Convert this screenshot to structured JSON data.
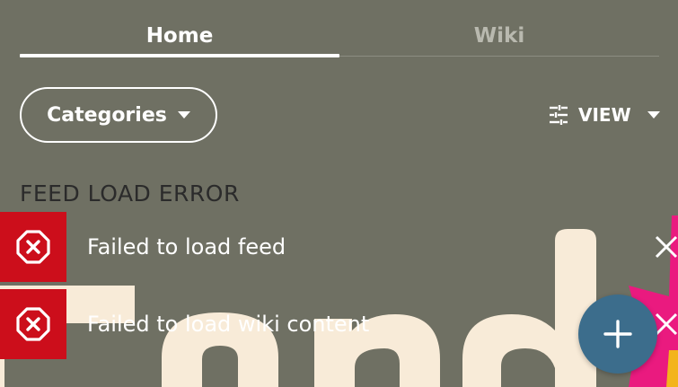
{
  "tabs": [
    {
      "label": "Home",
      "active": true
    },
    {
      "label": "Wiki",
      "active": false
    }
  ],
  "filters": {
    "categories_label": "Categories",
    "view_label": "VIEW"
  },
  "feed": {
    "title": "FEED LOAD ERROR",
    "errors": [
      {
        "message": "Failed to load feed"
      },
      {
        "message": "Failed to load wiki content"
      }
    ]
  },
  "icons": {
    "error": "error-octagon-x-icon",
    "close": "close-x-icon",
    "sliders": "sliders-icon",
    "dropdown": "caret-down-icon",
    "add": "plus-icon"
  },
  "colors": {
    "background": "#6f7063",
    "error_red": "#cc0e1b",
    "fab_blue": "#3c6d8c",
    "artwork_cream": "#f8ebd8",
    "artwork_pink": "#ea1a7f",
    "artwork_yellow": "#f3b41b"
  }
}
